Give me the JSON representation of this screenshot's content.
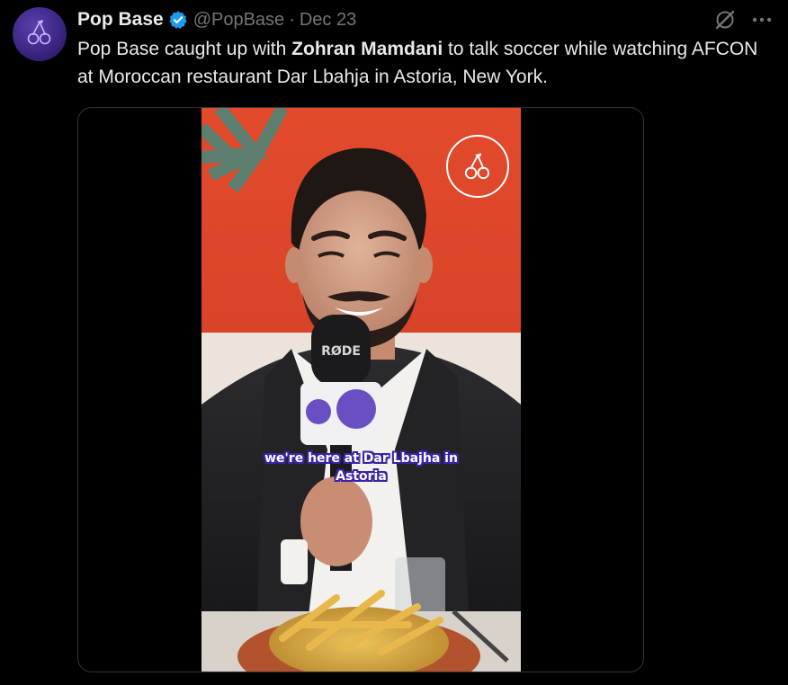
{
  "account": {
    "display_name": "Pop Base",
    "handle": "@PopBase",
    "separator": "·",
    "date": "Dec 23",
    "verified": true,
    "avatar_icon": "cherries-icon"
  },
  "tweet": {
    "text_before": "Pop Base caught up with ",
    "text_bold": "Zohran Mamdani",
    "text_after": " to talk soccer while watching AFCON at Moroccan restaurant Dar Lbahja in Astoria, New York."
  },
  "media": {
    "type": "video",
    "caption_line1": "we're here at Dar Lbajha in",
    "caption_line2": "Astoria",
    "microphone_brand": "RØDE",
    "watermark_icon": "cherries-icon"
  },
  "icons": {
    "grok": "grok-icon",
    "more": "more-options-icon",
    "verified": "verified-badge-icon"
  },
  "colors": {
    "background": "#000000",
    "text_primary": "#e7e9ea",
    "text_secondary": "#71767b",
    "verified_blue": "#1d9bf0",
    "avatar_purple": "#3a2480",
    "caption_outline": "#3d22a8",
    "flag_red": "#e0452a"
  }
}
